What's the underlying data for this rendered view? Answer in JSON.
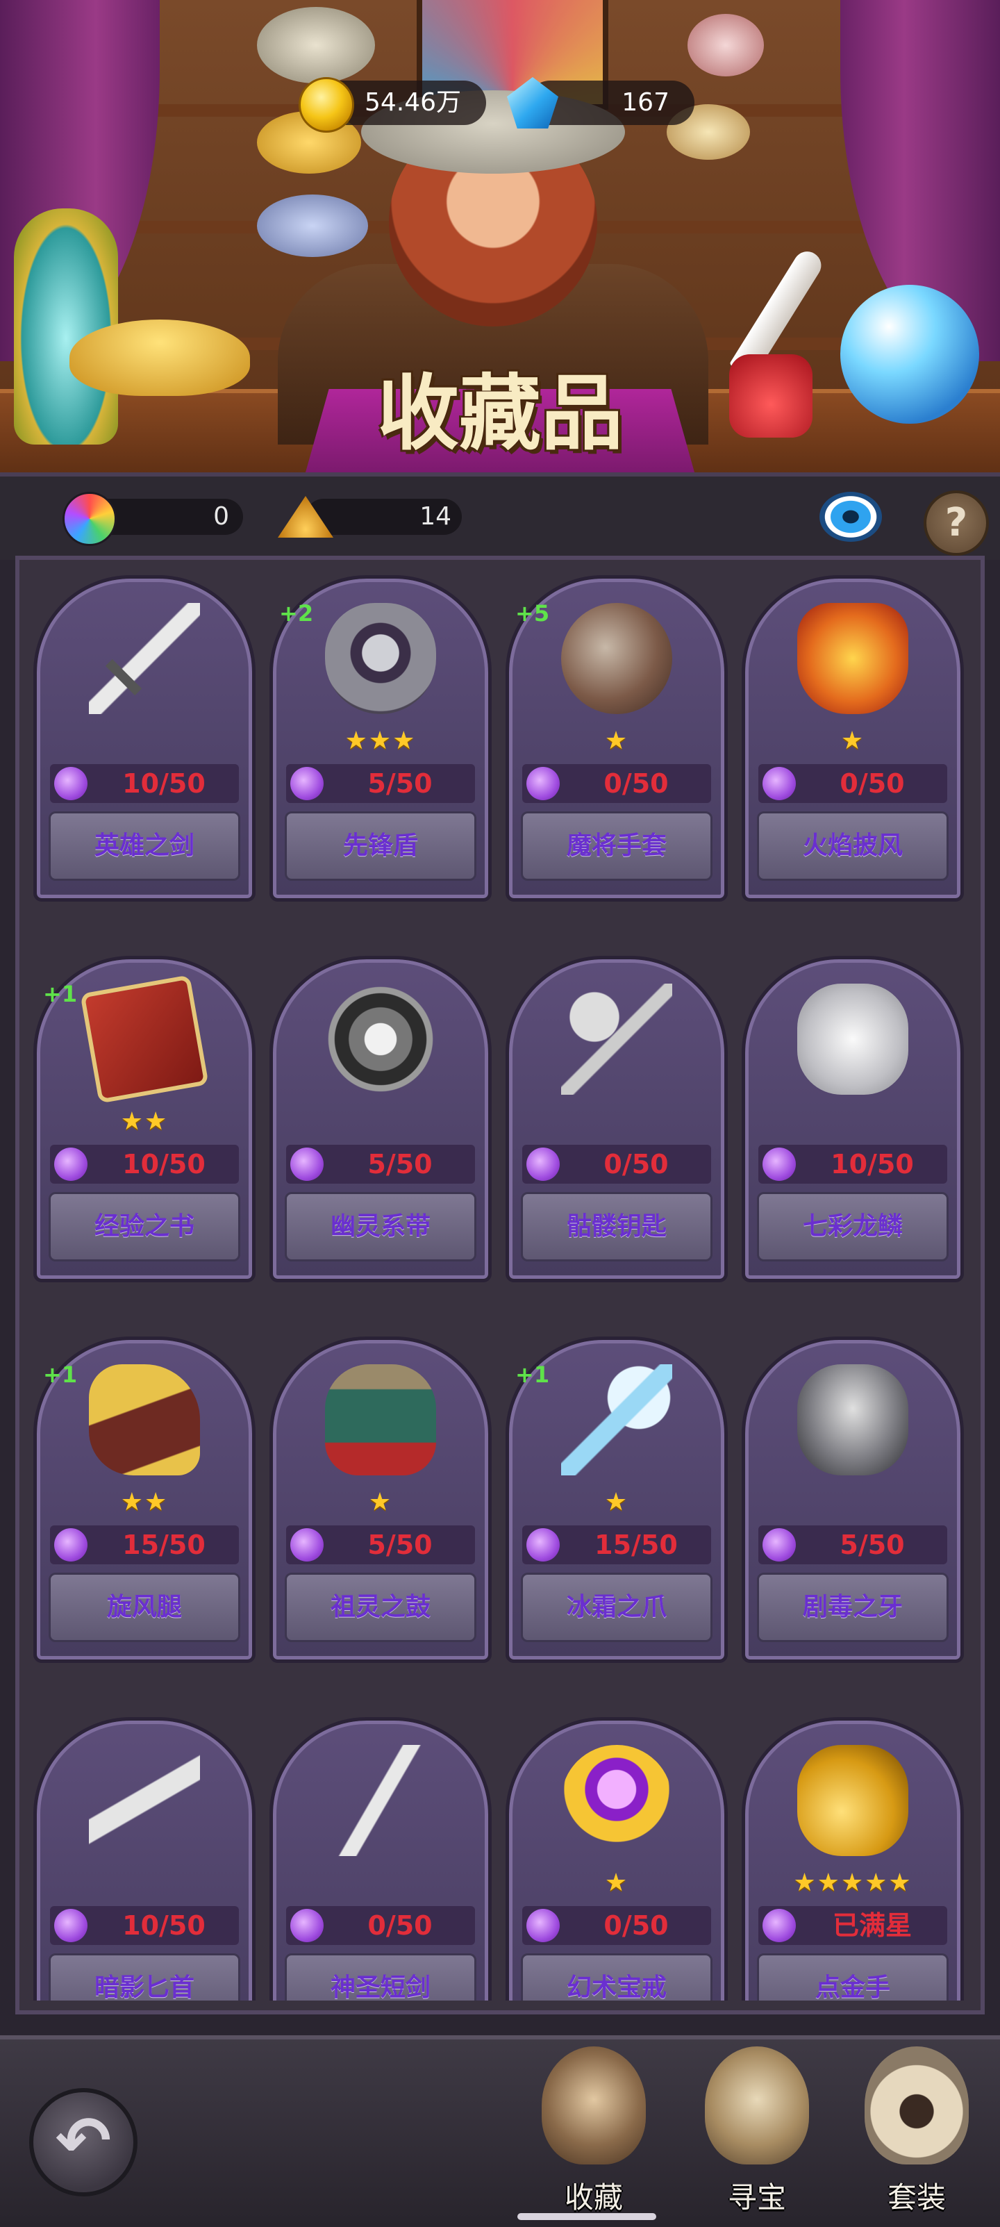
{
  "header": {
    "title": "收藏品",
    "gold": "54.46万",
    "gems": "167"
  },
  "resources": {
    "shards": "0",
    "dust": "14"
  },
  "help_label": "?",
  "items": [
    {
      "name": "英雄之剑",
      "progress": "10/50",
      "stars": "",
      "bonus": "",
      "icon": "sword-icon"
    },
    {
      "name": "先锋盾",
      "progress": "5/50",
      "stars": "★★★",
      "bonus": "+2",
      "icon": "shield-icon"
    },
    {
      "name": "魔将手套",
      "progress": "0/50",
      "stars": "★",
      "bonus": "+5",
      "icon": "gauntlet-icon"
    },
    {
      "name": "火焰披风",
      "progress": "0/50",
      "stars": "★",
      "bonus": "",
      "icon": "cape-icon"
    },
    {
      "name": "经验之书",
      "progress": "10/50",
      "stars": "★★",
      "bonus": "+1",
      "icon": "book-icon"
    },
    {
      "name": "幽灵系带",
      "progress": "5/50",
      "stars": "",
      "bonus": "",
      "icon": "belt-icon"
    },
    {
      "name": "骷髅钥匙",
      "progress": "0/50",
      "stars": "",
      "bonus": "",
      "icon": "key-icon"
    },
    {
      "name": "七彩龙鳞",
      "progress": "10/50",
      "stars": "",
      "bonus": "",
      "icon": "scale-icon"
    },
    {
      "name": "旋风腿",
      "progress": "15/50",
      "stars": "★★",
      "bonus": "+1",
      "icon": "boot-icon"
    },
    {
      "name": "祖灵之鼓",
      "progress": "5/50",
      "stars": "★",
      "bonus": "",
      "icon": "drum-icon"
    },
    {
      "name": "冰霜之爪",
      "progress": "15/50",
      "stars": "★",
      "bonus": "+1",
      "icon": "claw-icon"
    },
    {
      "name": "剧毒之牙",
      "progress": "5/50",
      "stars": "",
      "bonus": "",
      "icon": "fang-icon"
    },
    {
      "name": "暗影匕首",
      "progress": "10/50",
      "stars": "",
      "bonus": "",
      "icon": "dagger-icon"
    },
    {
      "name": "神圣短剑",
      "progress": "0/50",
      "stars": "",
      "bonus": "",
      "icon": "short-sword-icon"
    },
    {
      "name": "幻术宝戒",
      "progress": "0/50",
      "stars": "★",
      "bonus": "",
      "icon": "ring-icon"
    },
    {
      "name": "点金手",
      "progress": "已满星",
      "stars": "★★★★★",
      "bonus": "",
      "icon": "golden-fist-icon"
    }
  ],
  "nav": {
    "collect": "收藏",
    "treasure": "寻宝",
    "set": "套装"
  },
  "colors": {
    "progress_text": "#e22d3a",
    "item_name": "#6a2fd0",
    "bonus_text": "#5fe24a",
    "star": "#ffc928"
  }
}
